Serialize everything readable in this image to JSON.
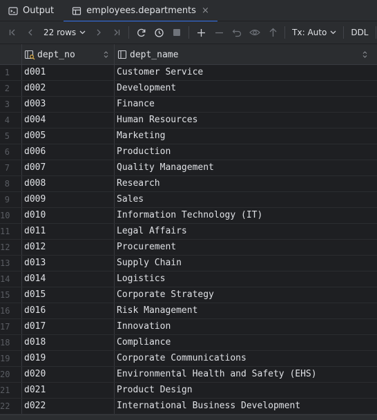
{
  "tabs": [
    {
      "label": "Output",
      "icon": "console-icon",
      "active": false
    },
    {
      "label": "employees.departments",
      "icon": "table-icon",
      "active": true,
      "close": "×"
    }
  ],
  "toolbar": {
    "rows_label": "22 rows",
    "tx_label": "Tx: Auto",
    "ddl_label": "DDL"
  },
  "columns": [
    {
      "name": "dept_no",
      "key": true
    },
    {
      "name": "dept_name",
      "key": false
    }
  ],
  "rows": [
    [
      "d001",
      "Customer Service"
    ],
    [
      "d002",
      "Development"
    ],
    [
      "d003",
      "Finance"
    ],
    [
      "d004",
      "Human Resources"
    ],
    [
      "d005",
      "Marketing"
    ],
    [
      "d006",
      "Production"
    ],
    [
      "d007",
      "Quality Management"
    ],
    [
      "d008",
      "Research"
    ],
    [
      "d009",
      "Sales"
    ],
    [
      "d010",
      "Information Technology (IT)"
    ],
    [
      "d011",
      "Legal Affairs"
    ],
    [
      "d012",
      "Procurement"
    ],
    [
      "d013",
      "Supply Chain"
    ],
    [
      "d014",
      "Logistics"
    ],
    [
      "d015",
      "Corporate Strategy"
    ],
    [
      "d016",
      "Risk Management"
    ],
    [
      "d017",
      "Innovation"
    ],
    [
      "d018",
      "Compliance"
    ],
    [
      "d019",
      "Corporate Communications"
    ],
    [
      "d020",
      "Environmental Health and Safety (EHS)"
    ],
    [
      "d021",
      "Product Design"
    ],
    [
      "d022",
      "International Business Development"
    ]
  ],
  "colors": {
    "accent": "#3574f0",
    "key_icon": "#d5a94a",
    "background": "#1e1f22"
  }
}
